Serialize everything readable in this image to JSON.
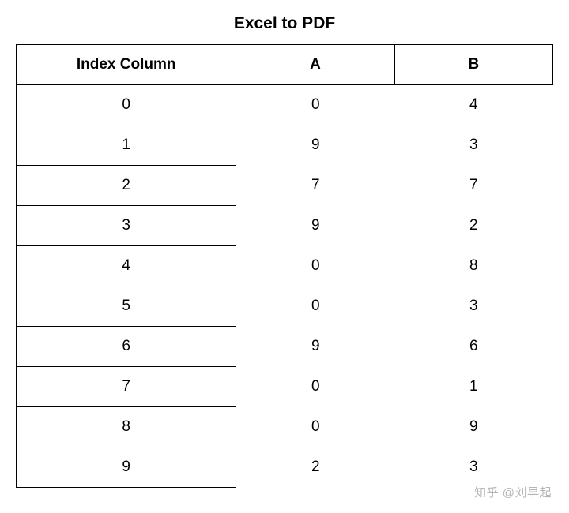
{
  "title": "Excel to PDF",
  "headers": {
    "index": "Index Column",
    "a": "A",
    "b": "B"
  },
  "rows": [
    {
      "index": "0",
      "a": "0",
      "b": "4"
    },
    {
      "index": "1",
      "a": "9",
      "b": "3"
    },
    {
      "index": "2",
      "a": "7",
      "b": "7"
    },
    {
      "index": "3",
      "a": "9",
      "b": "2"
    },
    {
      "index": "4",
      "a": "0",
      "b": "8"
    },
    {
      "index": "5",
      "a": "0",
      "b": "3"
    },
    {
      "index": "6",
      "a": "9",
      "b": "6"
    },
    {
      "index": "7",
      "a": "0",
      "b": "1"
    },
    {
      "index": "8",
      "a": "0",
      "b": "9"
    },
    {
      "index": "9",
      "a": "2",
      "b": "3"
    }
  ],
  "watermark": "知乎 @刘早起",
  "chart_data": {
    "type": "table",
    "title": "Excel to PDF",
    "columns": [
      "Index Column",
      "A",
      "B"
    ],
    "rows": [
      [
        0,
        0,
        4
      ],
      [
        1,
        9,
        3
      ],
      [
        2,
        7,
        7
      ],
      [
        3,
        9,
        2
      ],
      [
        4,
        0,
        8
      ],
      [
        5,
        0,
        3
      ],
      [
        6,
        9,
        6
      ],
      [
        7,
        0,
        1
      ],
      [
        8,
        0,
        9
      ],
      [
        9,
        2,
        3
      ]
    ]
  }
}
